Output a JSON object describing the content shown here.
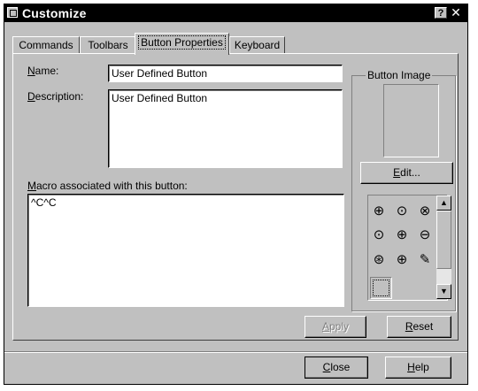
{
  "window": {
    "title": "Customize",
    "help_glyph": "?",
    "close_glyph": "✕"
  },
  "tabs": [
    {
      "label": "Commands",
      "active": false
    },
    {
      "label": "Toolbars",
      "active": false
    },
    {
      "label": "Button Properties",
      "active": true
    },
    {
      "label": "Keyboard",
      "active": false
    }
  ],
  "form": {
    "name_label_underlined": "N",
    "name_label_rest": "ame:",
    "name_value": "User Defined Button",
    "description_label_underlined": "D",
    "description_label_rest": "escription:",
    "description_value": "User Defined Button",
    "macro_label_underlined": "M",
    "macro_label_rest": "acro associated with this button:",
    "macro_value": "^C^C"
  },
  "button_image": {
    "group_label": "Button Image",
    "edit_underlined": "E",
    "edit_rest": "dit...",
    "icons": [
      "zoom-window-icon",
      "zoom-dynamic-icon",
      "zoom-extents-icon",
      "zoom-center-icon",
      "zoom-in-icon",
      "zoom-out-icon",
      "zoom-all-icon",
      "pan-icon",
      "pencil-icon"
    ],
    "icon_glyphs": [
      "⊕",
      "⊙",
      "⊗",
      "⊙",
      "⊕",
      "⊖",
      "⊛",
      "⊕",
      "✎"
    ]
  },
  "actions": {
    "apply_underlined": "A",
    "apply_rest": "pply",
    "reset_underlined": "R",
    "reset_rest": "eset",
    "close_underlined": "C",
    "close_rest": "lose",
    "help_underlined": "H",
    "help_rest": "elp"
  }
}
